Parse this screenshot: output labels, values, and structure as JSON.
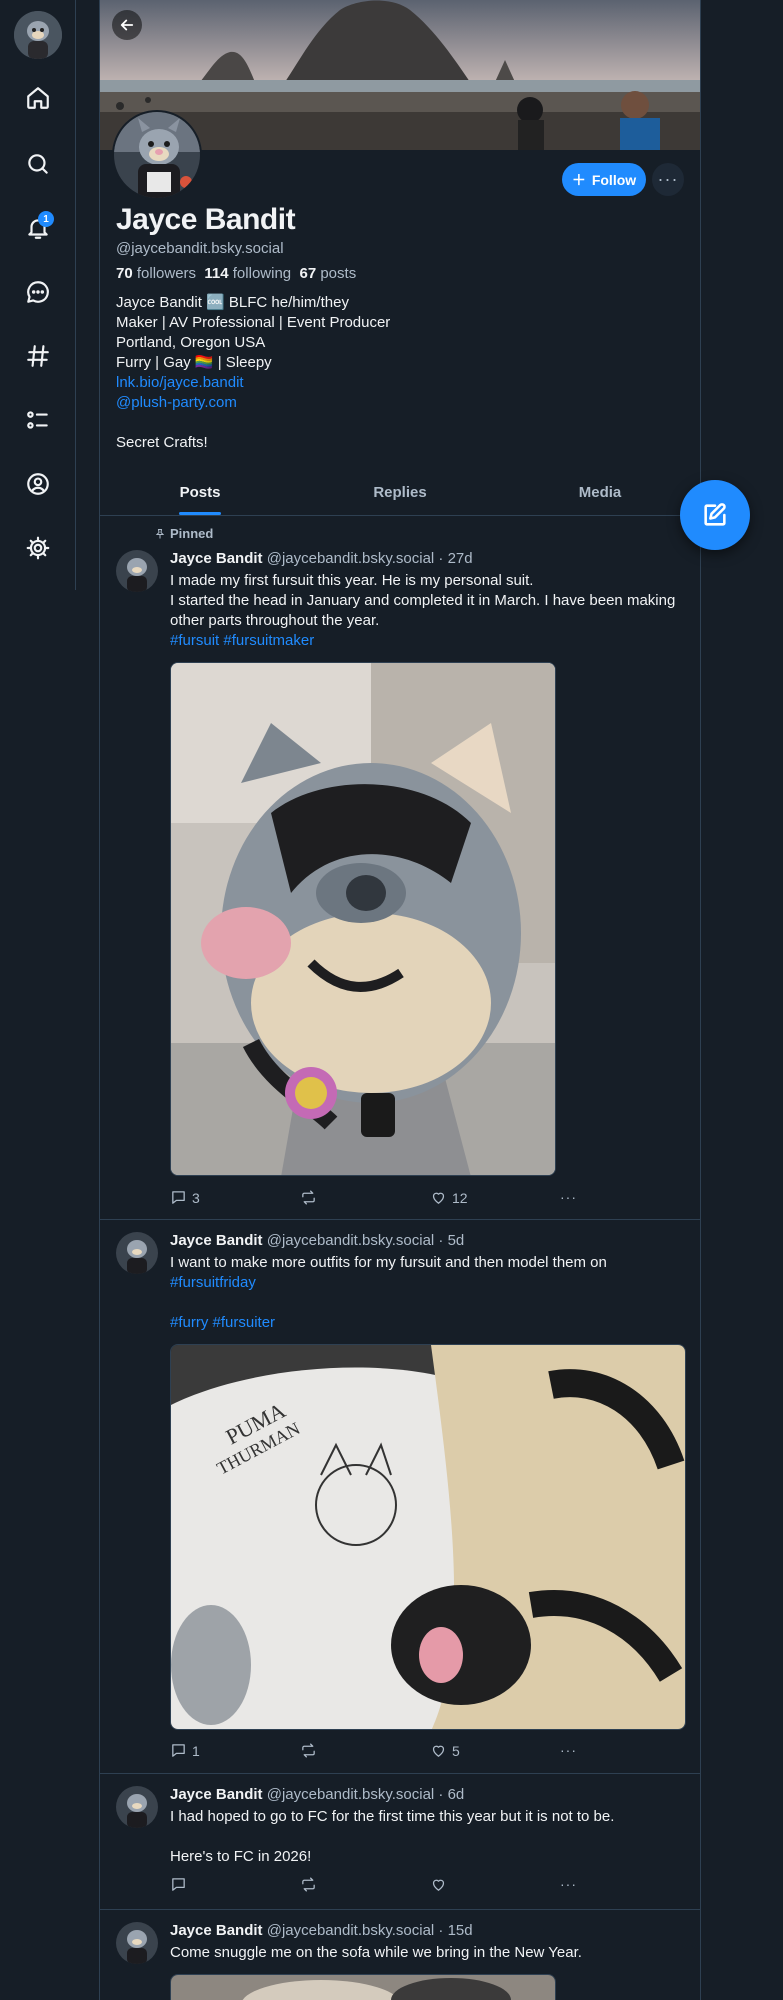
{
  "nav": {
    "notification_count": "1",
    "items": [
      "home",
      "search",
      "notifications",
      "chat",
      "feeds",
      "lists",
      "profile",
      "settings"
    ]
  },
  "profile": {
    "display_name": "Jayce Bandit",
    "handle": "@jaycebandit.bsky.social",
    "followers_count": "70",
    "followers_label": "followers",
    "following_count": "114",
    "following_label": "following",
    "posts_count": "67",
    "posts_label": "posts",
    "follow_label": "Follow",
    "bio": {
      "line1": "Jayce Bandit 🆒 BLFC he/him/they",
      "line2": "Maker | AV Professional | Event Producer",
      "line3": "Portland, Oregon USA",
      "line4": "Furry | Gay 🏳️‍🌈 | Sleepy",
      "link1": "lnk.bio/jayce.bandit",
      "link2": "@plush-party.com",
      "line5": "Secret Crafts!"
    }
  },
  "tabs": [
    "Posts",
    "Replies",
    "Media"
  ],
  "posts": [
    {
      "pinned_label": "Pinned",
      "author": "Jayce Bandit",
      "handle": "@jaycebandit.bsky.social",
      "time": "· 27d",
      "text1": "I made my first fursuit this year. He is my personal suit.",
      "text2": "I started the head in January and completed it in March. I have been making other parts throughout the year.",
      "tags": "#fursuit #fursuitmaker",
      "replies": "3",
      "reposts": "",
      "likes": "12"
    },
    {
      "author": "Jayce Bandit",
      "handle": "@jaycebandit.bsky.social",
      "time": "· 5d",
      "text1": "I want to make more outfits for my fursuit and then model them on",
      "tag1": "#fursuitfriday",
      "tags": "#furry #fursuiter",
      "replies": "1",
      "reposts": "",
      "likes": "5"
    },
    {
      "author": "Jayce Bandit",
      "handle": "@jaycebandit.bsky.social",
      "time": "· 6d",
      "text1": "I had hoped to go to FC for the first time this year but it is not to be.",
      "text2": "Here's to FC in 2026!",
      "replies": "",
      "reposts": "",
      "likes": ""
    },
    {
      "author": "Jayce Bandit",
      "handle": "@jaycebandit.bsky.social",
      "time": "· 15d",
      "text1": "Come snuggle me on the sofa while we bring in the New Year."
    }
  ],
  "colors": {
    "background": "#161e27",
    "accent": "#208bfe",
    "border": "#2e4052",
    "muted_text": "#aebbc9"
  }
}
